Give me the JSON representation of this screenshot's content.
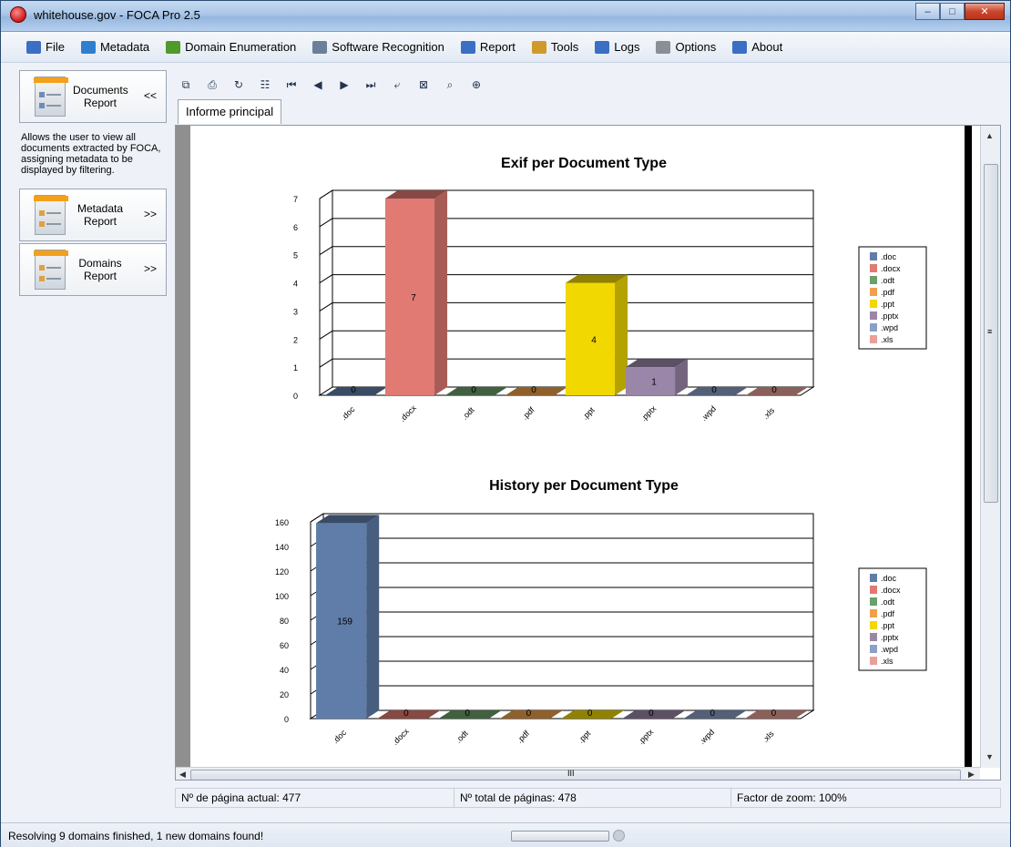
{
  "window": {
    "title": "whitehouse.gov - FOCA Pro 2.5",
    "controls": {
      "minimize": "–",
      "maximize": "□",
      "close": "✕"
    }
  },
  "menu": [
    {
      "id": "file",
      "label": "File",
      "icon": "file-icon",
      "color": "#3a6fc4"
    },
    {
      "id": "metadata",
      "label": "Metadata",
      "icon": "metadata-icon",
      "color": "#2f7fd0"
    },
    {
      "id": "domain-enumeration",
      "label": "Domain Enumeration",
      "icon": "network-icon",
      "color": "#4f9a2a"
    },
    {
      "id": "software-recognition",
      "label": "Software Recognition",
      "icon": "software-icon",
      "color": "#6b7f99"
    },
    {
      "id": "report",
      "label": "Report",
      "icon": "report-icon",
      "color": "#3a6fc4"
    },
    {
      "id": "tools",
      "label": "Tools",
      "icon": "tools-icon",
      "color": "#d09a2a"
    },
    {
      "id": "logs",
      "label": "Logs",
      "icon": "logs-icon",
      "color": "#3a6fc4"
    },
    {
      "id": "options",
      "label": "Options",
      "icon": "gear-icon",
      "color": "#8a8f96"
    },
    {
      "id": "about",
      "label": "About",
      "icon": "about-icon",
      "color": "#3a6fc4"
    }
  ],
  "left_panel": {
    "documents_report": {
      "label": "Documents Report",
      "arrow": "<<"
    },
    "description": "Allows the user to view all documents extracted by FOCA, assigning metadata to be displayed by filtering.",
    "metadata_report": {
      "label": "Metadata Report",
      "arrow": ">>"
    },
    "domains_report": {
      "label": "Domains Report",
      "arrow": ">>"
    }
  },
  "toolbar": {
    "buttons": [
      "export-icon",
      "print-icon",
      "refresh-icon",
      "tree-icon",
      "first-page-icon",
      "prev-page-icon",
      "next-page-icon",
      "last-page-icon",
      "back-icon",
      "stop-icon",
      "find-icon",
      "zoom-icon"
    ]
  },
  "tab": {
    "label": "Informe principal"
  },
  "chart_data": [
    {
      "type": "bar",
      "title": "Exif per Document Type",
      "categories": [
        ".doc",
        ".docx",
        ".odt",
        ".pdf",
        ".ppt",
        ".pptx",
        ".wpd",
        ".xls"
      ],
      "values": [
        0,
        7,
        0,
        0,
        4,
        1,
        0,
        0
      ],
      "ylim": [
        0,
        7
      ],
      "yticks": [
        0,
        1,
        2,
        3,
        4,
        5,
        6,
        7
      ],
      "legend": [
        ".doc",
        ".docx",
        ".odt",
        ".pdf",
        ".ppt",
        ".pptx",
        ".wpd",
        ".xls"
      ],
      "legend_position": "right",
      "grid": true,
      "colors": [
        "#5f7da8",
        "#e07a72",
        "#6aa06a",
        "#f0a04a",
        "#f0d800",
        "#9a86a8",
        "#8aa0c8",
        "#e8a098"
      ]
    },
    {
      "type": "bar",
      "title": "History per Document Type",
      "categories": [
        ".doc",
        ".docx",
        ".odt",
        ".pdf",
        ".ppt",
        ".pptx",
        ".wpd",
        ".xls"
      ],
      "values": [
        159,
        0,
        0,
        0,
        0,
        0,
        0,
        0
      ],
      "ylim": [
        0,
        160
      ],
      "yticks": [
        0,
        20,
        40,
        60,
        80,
        100,
        120,
        140,
        160
      ],
      "legend": [
        ".doc",
        ".docx",
        ".odt",
        ".pdf",
        ".ppt",
        ".pptx",
        ".wpd",
        ".xls"
      ],
      "legend_position": "right",
      "grid": true,
      "colors": [
        "#5f7da8",
        "#e07a72",
        "#6aa06a",
        "#f0a04a",
        "#f0d800",
        "#9a86a8",
        "#8aa0c8",
        "#e8a098"
      ]
    }
  ],
  "page_status": {
    "current": "Nº de página actual: 477",
    "total": "Nº total de páginas: 478",
    "zoom": "Factor de zoom: 100%"
  },
  "status": {
    "text": "Resolving 9 domains finished, 1 new domains found!",
    "progress": 0.0
  },
  "scroll": {
    "hscroll_label": "III",
    "vscroll_grip": "≡"
  }
}
